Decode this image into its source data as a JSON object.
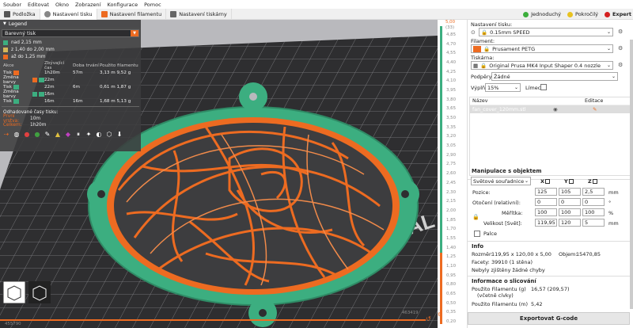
{
  "menu": [
    "Soubor",
    "Editovat",
    "Okno",
    "Zobrazení",
    "Konfigurace",
    "Pomoc"
  ],
  "tabs": [
    {
      "label": "Podložka",
      "active": false
    },
    {
      "label": "Nastavení tisku",
      "active": true
    },
    {
      "label": "Nastavení filamentu",
      "active": false
    },
    {
      "label": "Nastavení tiskárny",
      "active": false
    }
  ],
  "modes": [
    {
      "label": "Jednoduchý",
      "color": "#3cae3c",
      "active": false
    },
    {
      "label": "Pokročilý",
      "color": "#e8c220",
      "active": false
    },
    {
      "label": "Expert",
      "color": "#d42020",
      "active": true
    }
  ],
  "legend": {
    "title": "Legend",
    "view_type": "Barevný tisk",
    "ranges": [
      {
        "label": "nad 2,15 mm",
        "color": "#3cae80"
      },
      {
        "label": "z 1,40 do 2,00 mm",
        "color": "#d6b85a"
      },
      {
        "label": "až do 1,25 mm",
        "color": "#ed6b21"
      }
    ],
    "columns": {
      "action": "Akce",
      "remaining": "Zbývající čas",
      "duration": "Doba trvání",
      "used": "Použito filamentu"
    },
    "actions": [
      {
        "name": "Tisk",
        "remaining": "1h20m",
        "duration": "57m",
        "length": "3,13 m",
        "weight": "9,52 g",
        "colors": [
          "#ed6b21"
        ]
      },
      {
        "name": "Změna barvy",
        "remaining": "22m",
        "duration": "",
        "length": "",
        "weight": "",
        "colors": [
          "#ed6b21",
          "#3cae80"
        ]
      },
      {
        "name": "Tisk",
        "remaining": "22m",
        "duration": "6m",
        "length": "0,61 m",
        "weight": "1,87 g",
        "colors": [
          "#3cae80"
        ]
      },
      {
        "name": "Změna barvy",
        "remaining": "16m",
        "duration": "",
        "length": "",
        "weight": "",
        "colors": [
          "#3cae80",
          "#3cae80"
        ]
      },
      {
        "name": "Tisk",
        "remaining": "16m",
        "duration": "16m",
        "length": "1,68 m",
        "weight": "5,13 g",
        "colors": [
          "#3cae80"
        ]
      }
    ],
    "estimate_title": "Odhadované časy tisku:",
    "first_layer_label": "První vrstva:",
    "first_layer_value": "10m",
    "total_label": "Celkem:",
    "total_value": "1h20m"
  },
  "slider": {
    "top_value": "5,00",
    "top_layer": "(33)",
    "ticks": [
      "4,85",
      "4,70",
      "4,55",
      "4,40",
      "4,25",
      "4,10",
      "3,95",
      "3,80",
      "3,65",
      "3,50",
      "3,35",
      "3,20",
      "3,05",
      "2,90",
      "2,75",
      "2,60",
      "2,45",
      "2,30",
      "2,15",
      "2,00",
      "1,85",
      "1,70",
      "1,55",
      "1,40",
      "1,25",
      "1,10",
      "0,95",
      "0,80",
      "0,65",
      "0,50",
      "0,35",
      "0,20"
    ],
    "bottom_left": "455790",
    "bottom_right": "463419"
  },
  "panel": {
    "print_settings_label": "Nastavení tisku:",
    "print_profile": "0.15mm SPEED",
    "filament_label": "Filament:",
    "filament_profile": "Prusament PETG",
    "filament_color": "#ed6b21",
    "printer_label": "Tiskárna:",
    "printer_profile": "Original Prusa MK4 Input Shaper 0.4 nozzle",
    "supports_label": "Podpěry:",
    "supports_value": "Žádné",
    "infill_label": "Výplň:",
    "infill_value": "15%",
    "brim_label": "Límec:",
    "list_name_col": "Název",
    "list_edit_col": "Editace",
    "object_name": "fan_cover_120mm.stl",
    "manipulation_title": "Manipulace s objektem",
    "coord_system": "Světové souřadnice",
    "axes": [
      "X",
      "Y",
      "Z"
    ],
    "position_label": "Pozice:",
    "position": [
      "125",
      "105",
      "2,5"
    ],
    "position_unit": "mm",
    "rotation_label": "Otočení (relativní):",
    "rotation": [
      "0",
      "0",
      "0"
    ],
    "rotation_unit": "°",
    "scale_label": "Měřítka:",
    "scale": [
      "100",
      "100",
      "100"
    ],
    "scale_unit": "%",
    "size_label": "Velikost [Svět]:",
    "size": [
      "119,95",
      "120",
      "5"
    ],
    "size_unit": "mm",
    "inches_label": "Palce",
    "info_title": "Info",
    "size_info_label": "Rozměr:",
    "size_info_value": "119,95 x 120,00 x 5,00",
    "volume_label": "Objem:",
    "volume_value": "15470,85",
    "facets_label": "Facety:",
    "facets_value": "39910 (1 stěna)",
    "errors_text": "Nebyly zjištěny žádné chyby",
    "slicing_title": "Informace o slicování",
    "used_g_label": "Použito Filamentu (g)",
    "used_g_sub": "(včetně cívky)",
    "used_g_value": "16,57 (209,57)",
    "used_m_label": "Použito Filamentu (m)",
    "used_m_value": "5,42",
    "export_label": "Exportovat G-code"
  },
  "bed_text": "ORIGINAL"
}
